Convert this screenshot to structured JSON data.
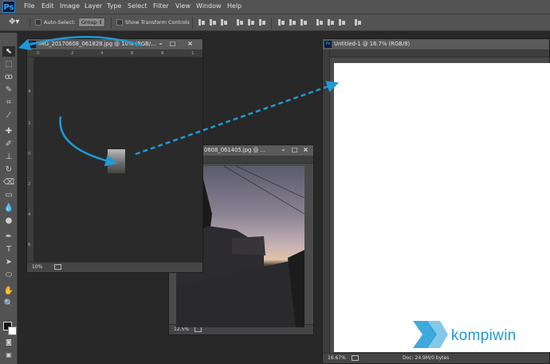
{
  "app": {
    "logo": "Ps"
  },
  "menu": [
    "File",
    "Edit",
    "Image",
    "Layer",
    "Type",
    "Select",
    "Filter",
    "View",
    "Window",
    "Help"
  ],
  "options": {
    "auto_select_label": "Auto-Select:",
    "group_value": "Group",
    "show_transform_label": "Show Transform Controls"
  },
  "doc1": {
    "title": "IMG_20170608_061828.jpg @ 10% (RGB/...",
    "zoom": "10%",
    "ruler_numbers": [
      "0",
      "2",
      "4",
      "6",
      "8",
      "1"
    ],
    "vruler_numbers": [
      "4",
      "2",
      "0",
      "2",
      "4",
      "6"
    ]
  },
  "doc2": {
    "title": "0608_061405.jpg @ ...",
    "zoom": "12.5%"
  },
  "doc3": {
    "title": "Untitled-1 @ 16.7% (RGB/8)",
    "zoom": "16.67%",
    "doc_info": "Doc: 24.9M/0 bytes"
  },
  "watermark": {
    "text": "kompiwin"
  },
  "colors": {
    "accent_arrow": "#1f9ad6",
    "ui_dark": "#282828",
    "ui_panel": "#535353"
  }
}
